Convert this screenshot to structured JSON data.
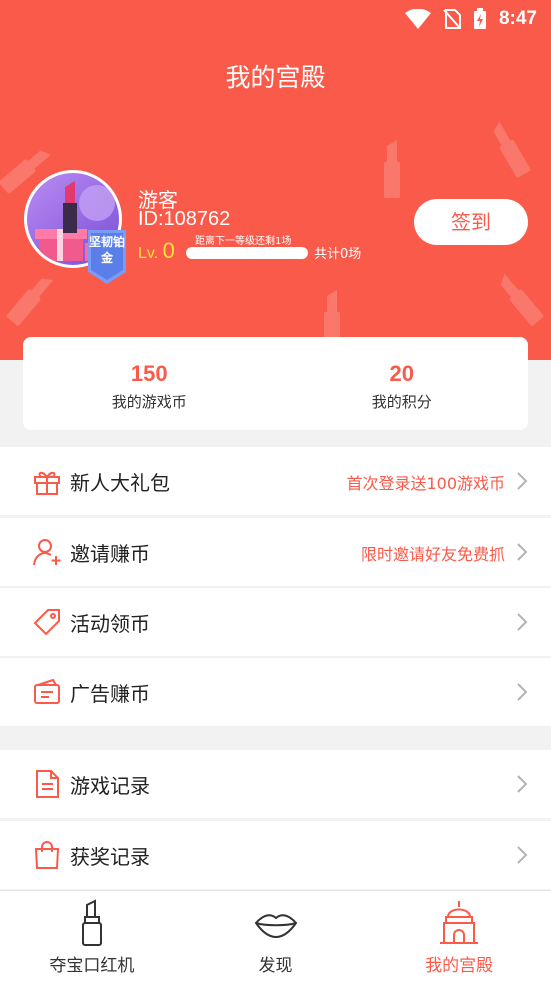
{
  "status_bar": {
    "time": "8:47",
    "icons": [
      "wifi-icon",
      "no-sim-icon",
      "battery-charging-icon"
    ]
  },
  "header": {
    "title": "我的宫殿"
  },
  "profile": {
    "name": "游客",
    "id": "ID:108762",
    "level_prefix": "Lv.",
    "level": "0",
    "next_level_tip": "距离下一等级还剩1场",
    "level_progress": 0,
    "total": "共计0场",
    "badge_text": "坚韧铂金",
    "checkin_label": "签到"
  },
  "stats": [
    {
      "value": "150",
      "label": "我的游戏币"
    },
    {
      "value": "20",
      "label": "我的积分"
    }
  ],
  "menu": [
    {
      "icon": "gift-icon",
      "label": "新人大礼包",
      "hint": "首次登录送100游戏币"
    },
    {
      "icon": "user-add-icon",
      "label": "邀请赚币",
      "hint": "限时邀请好友免费抓"
    },
    {
      "icon": "tag-icon",
      "label": "活动领币",
      "hint": ""
    },
    {
      "icon": "ad-card-icon",
      "label": "广告赚币",
      "hint": ""
    },
    {
      "icon": "document-icon",
      "label": "游戏记录",
      "hint": ""
    },
    {
      "icon": "shopping-bag-icon",
      "label": "获奖记录",
      "hint": ""
    }
  ],
  "tabs": [
    {
      "icon": "lipstick-icon",
      "label": "夺宝口红机",
      "active": false
    },
    {
      "icon": "lips-icon",
      "label": "发现",
      "active": false
    },
    {
      "icon": "palace-icon",
      "label": "我的宫殿",
      "active": true
    }
  ],
  "colors": {
    "accent": "#fa5a4a",
    "background": "#f2f2f2",
    "level": "#ffe23a"
  }
}
